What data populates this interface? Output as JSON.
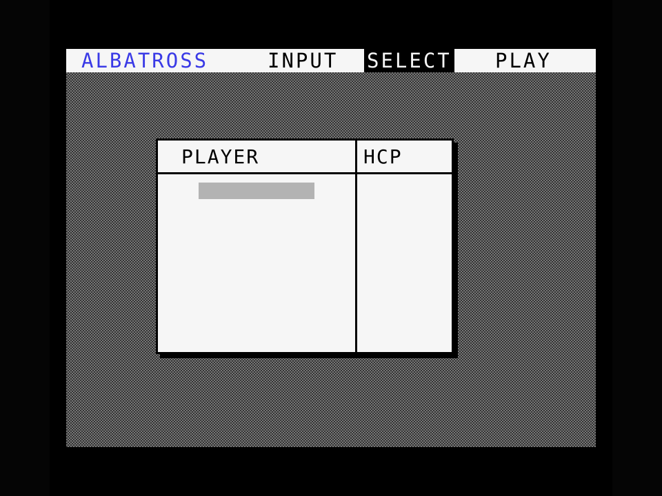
{
  "menubar": {
    "app_title": "ALBATROSS",
    "items": [
      {
        "label": "INPUT",
        "selected": false
      },
      {
        "label": "SELECT",
        "selected": true
      },
      {
        "label": "PLAY",
        "selected": false
      }
    ]
  },
  "player_table": {
    "columns": [
      "PLAYER",
      "HCP"
    ],
    "rows": []
  },
  "colors": {
    "title": "#3a3ae6",
    "menu_bg": "#f6f6f6",
    "selected_bg": "#000000",
    "selection_cursor": "#b3b3b3"
  }
}
